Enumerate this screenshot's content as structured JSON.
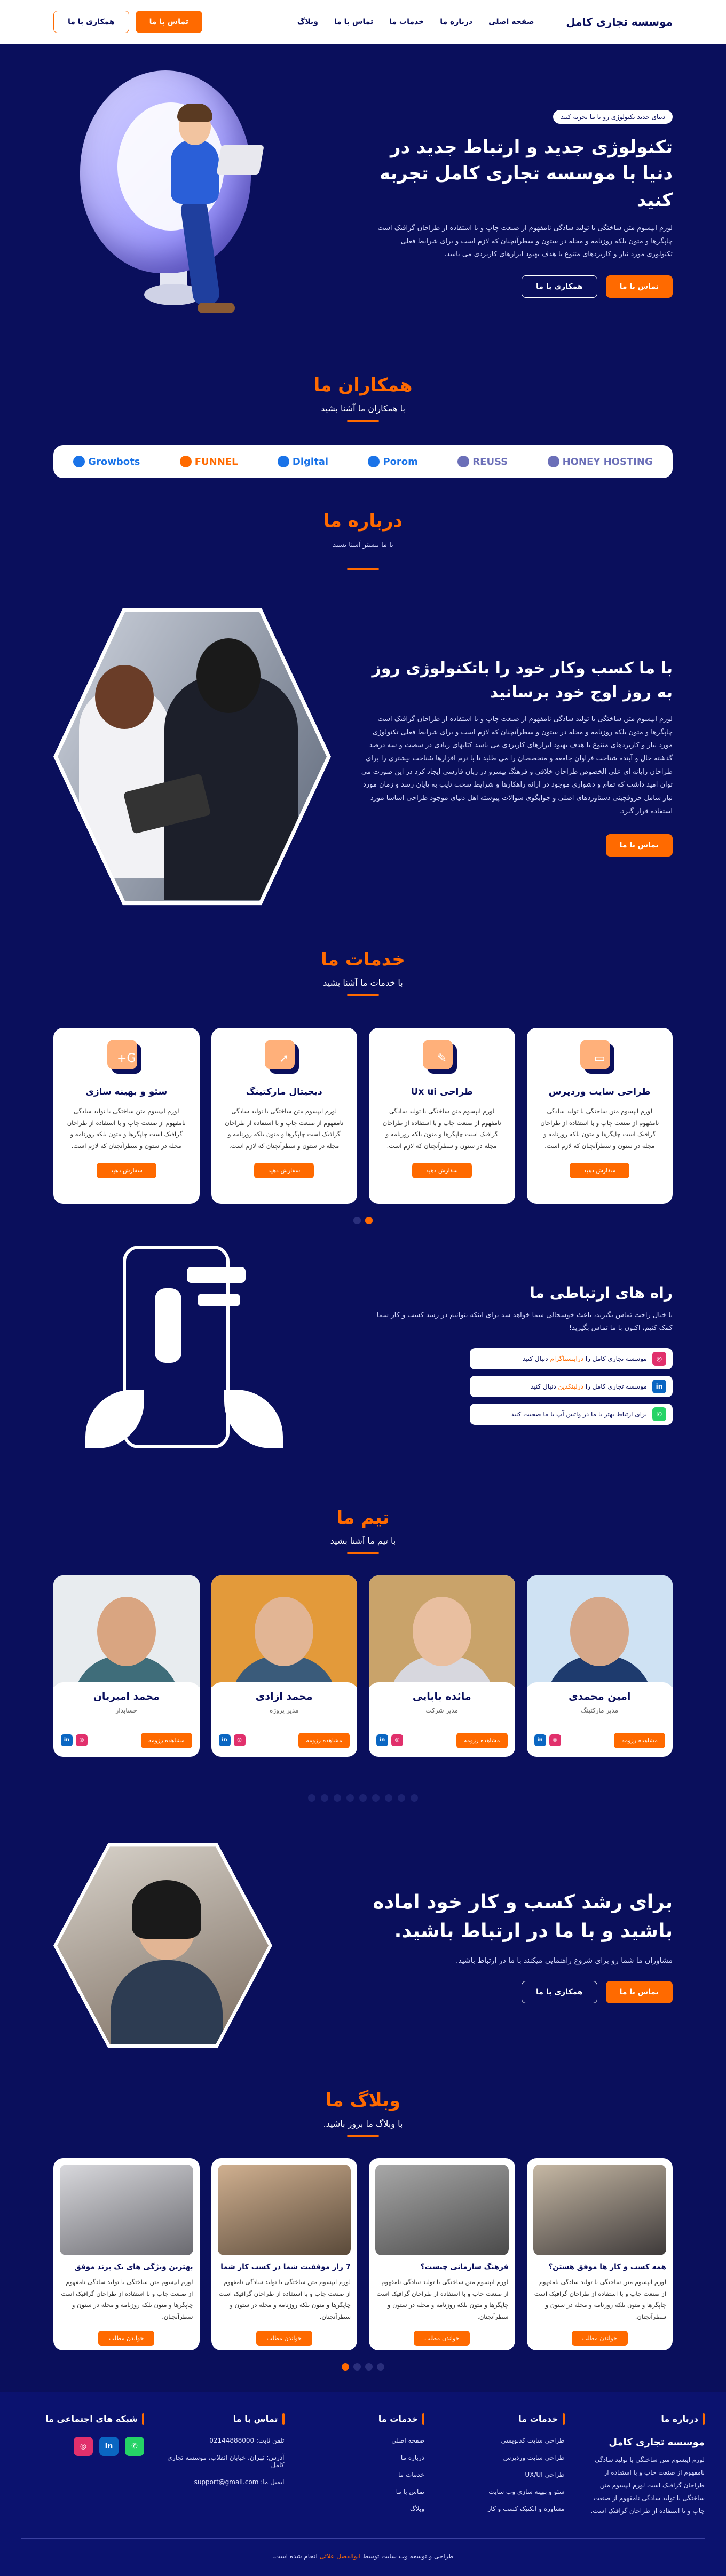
{
  "header": {
    "brand": "موسسه تجاری کامل",
    "nav": [
      "صفحه اصلی",
      "درباره ما",
      "خدمات ما",
      "تماس با ما",
      "وبلاگ"
    ],
    "contact_btn": "تماس با ما",
    "coop_btn": "همکاری با ما"
  },
  "hero": {
    "pill": "دنیای جدید تکنولوژی رو با ما تجربه کنید",
    "title": "تکنولوژی جدید و ارتباط جدید در دنیا با موسسه تجاری کامل تجربه کنید",
    "desc": "لورم ایپسوم متن ساختگی با تولید سادگی نامفهوم از صنعت چاپ و با استفاده از طراحان گرافیک است چاپگرها و متون بلکه روزنامه و مجله در ستون و سطرآنچنان که لازم است و برای شرایط فعلی تکنولوژی مورد نیاز و کاربردهای متنوع با هدف بهبود ابزارهای کاربردی می باشد.",
    "contact_btn": "تماس با ما",
    "coop_btn": "همکاری با ما"
  },
  "partners": {
    "title": "همکاران ما",
    "subtitle": "با همکاران ما آشنا بشید",
    "logos": [
      {
        "name": "Growbots",
        "color": "#1a73e8"
      },
      {
        "name": "FUNNEL",
        "color": "#ff6a00"
      },
      {
        "name": "Digital",
        "color": "#1a73e8"
      },
      {
        "name": "Porom",
        "color": "#1a73e8"
      },
      {
        "name": "REUSS",
        "color": "#6b6fb8"
      },
      {
        "name": "HONEY HOSTING",
        "color": "#6b6fb8"
      }
    ]
  },
  "about": {
    "title": "درباره ما",
    "subtitle": "با ما بیشتر آشنا بشید",
    "heading": "با ما کسب وکار خود را باتکنولوژی روز به روز اوج خود برسانید",
    "desc": "لورم ایپسوم متن ساختگی با تولید سادگی نامفهوم از صنعت چاپ و با استفاده از طراحان گرافیک است چاپگرها و متون بلکه روزنامه و مجله در ستون و سطرآنچنان که لازم است و برای شرایط فعلی تکنولوژی مورد نیاز و کاربردهای متنوع با هدف بهبود ابزارهای کاربردی می باشد کتابهای زیادی در شصت و سه درصد گذشته حال و آینده شناخت فراوان جامعه و متخصصان را می طلبد تا با نرم افزارها شناخت بیشتری را برای طراحان رایانه ای علی الخصوص طراحان خلاقی و فرهنگ پیشرو در زبان فارسی ایجاد کرد در این صورت می توان امید داشت که تمام و دشواری موجود در ارائه راهکارها و شرایط سخت تایپ به پایان رسد و زمان مورد نیاز شامل حروفچینی دستاوردهای اصلی و جوابگوی سوالات پیوسته اهل دنیای موجود طراحی اساسا مورد استفاده قرار گیرد.",
    "btn": "تماس با ما"
  },
  "services": {
    "title": "خدمات ما",
    "subtitle": "با خدمات ما آشنا بشید",
    "items": [
      {
        "title": "طراحی سایت وردپرس",
        "icon": "monitor-icon",
        "glyph": "▭",
        "desc": "لورم ایپسوم متن ساختگی با تولید سادگی نامفهوم از صنعت چاپ و با استفاده از طراحان گرافیک است چاپگرها و متون بلکه روزنامه و مجله در ستون و سطرآنچنان که لازم است.",
        "btn": "سفارش دهید"
      },
      {
        "title": "طراحی Ux ui",
        "icon": "pen-tool-icon",
        "glyph": "✎",
        "desc": "لورم ایپسوم متن ساختگی با تولید سادگی نامفهوم از صنعت چاپ و با استفاده از طراحان گرافیک است چاپگرها و متون بلکه روزنامه و مجله در ستون و سطرآنچنان که لازم است.",
        "btn": "سفارش دهید"
      },
      {
        "title": "دیجیتال مارکتینگ",
        "icon": "rocket-icon",
        "glyph": "➚",
        "desc": "لورم ایپسوم متن ساختگی با تولید سادگی نامفهوم از صنعت چاپ و با استفاده از طراحان گرافیک است چاپگرها و متون بلکه روزنامه و مجله در ستون و سطرآنچنان که لازم است.",
        "btn": "سفارش دهید"
      },
      {
        "title": "سئو و بهینه سازی",
        "icon": "google-plus-icon",
        "glyph": "G+",
        "desc": "لورم ایپسوم متن ساختگی با تولید سادگی نامفهوم از صنعت چاپ و با استفاده از طراحان گرافیک است چاپگرها و متون بلکه روزنامه و مجله در ستون و سطرآنچنان که لازم است.",
        "btn": "سفارش دهید"
      }
    ]
  },
  "contact": {
    "title": "راه های ارتباطی ما",
    "desc": "با خیال راحت تماس بگیرید، باعث خوشحالی شما خواهد شد برای اینکه بتوانیم در رشد کسب و کار شما کمک کنیم، اکنون با ما تماس بگیرید!",
    "items": [
      {
        "text": "موسسه تجاری کامل را",
        "link": "دراینستاگرام",
        "after": "دنبال کنید",
        "icon": "instagram-icon",
        "glyph": "◎",
        "color": "#e1306c"
      },
      {
        "text": "موسسه تجاری کامل را",
        "link": "درلینکدین",
        "after": "دنبال کنید",
        "icon": "linkedin-icon",
        "glyph": "in",
        "color": "#0a66c2"
      },
      {
        "text": "برای ارتباط بهتر با ما در واتس آپ با ما صحبت کنید",
        "link": "",
        "after": "",
        "icon": "whatsapp-icon",
        "glyph": "✆",
        "color": "#25d366"
      }
    ]
  },
  "team": {
    "title": "تیم ما",
    "subtitle": "با تیم ما آشنا بشید",
    "members": [
      {
        "name": "امین محمدی",
        "role": "مدیر مارکتینگ",
        "btn": "مشاهده رزومه",
        "skin": "#d6a88a",
        "cloth": "#1e3b6e",
        "bg": "#cfe2f3"
      },
      {
        "name": "مائده بابایی",
        "role": "مدیر شرکت",
        "btn": "مشاهده رزومه",
        "skin": "#e9bfa0",
        "cloth": "#d7d7de",
        "bg": "#c9a36a"
      },
      {
        "name": "محمد ازادی",
        "role": "مدیر پروژه",
        "btn": "مشاهده رزومه",
        "skin": "#e2b594",
        "cloth": "#3a5b7a",
        "bg": "#e39a3a"
      },
      {
        "name": "محمد امیریان",
        "role": "حسابدار",
        "btn": "مشاهده رزومه",
        "skin": "#d9a581",
        "cloth": "#3f6d7a",
        "bg": "#e8ecef"
      }
    ],
    "dot_count": 9,
    "active_dot": 4
  },
  "cta": {
    "title": "برای رشد کسب و کار خود اماده باشید و با ما در ارتباط باشید.",
    "desc": "مشاوران ما شما رو برای شروع راهنمایی میکنند با ما در ارتباط باشید.",
    "contact_btn": "تماس با ما",
    "coop_btn": "همکاری با ما"
  },
  "blog": {
    "title": "وبلاگ ما",
    "subtitle": "با وبلاگ ما بروز باشید.",
    "posts": [
      {
        "title": "همه کسب و کار ها موفق هستن؟",
        "desc": "لورم ایپسوم متن ساختگی با تولید سادگی نامفهوم از صنعت چاپ و با استفاده از طراحان گرافیک است چاپگرها و متون بلکه روزنامه و مجله در ستون و سطرآنچنان.",
        "btn": "خواندن مطلب",
        "bg1": "#c6b8a4",
        "bg2": "#3e3a3a"
      },
      {
        "title": "فرهنگ سازمانی چیست؟",
        "desc": "لورم ایپسوم متن ساختگی با تولید سادگی نامفهوم از صنعت چاپ و با استفاده از طراحان گرافیک است چاپگرها و متون بلکه روزنامه و مجله در ستون و سطرآنچنان.",
        "btn": "خواندن مطلب",
        "bg1": "#a8a8a8",
        "bg2": "#4a4a4a"
      },
      {
        "title": "7 راز موفقیت شما در کسب کار شما",
        "desc": "لورم ایپسوم متن ساختگی با تولید سادگی نامفهوم از صنعت چاپ و با استفاده از طراحان گرافیک است چاپگرها و متون بلکه روزنامه و مجله در ستون و سطرآنچنان.",
        "btn": "خواندن مطلب",
        "bg1": "#d0b090",
        "bg2": "#5a4a3a"
      },
      {
        "title": "بهترین ویژگی های یک برند موفق",
        "desc": "لورم ایپسوم متن ساختگی با تولید سادگی نامفهوم از صنعت چاپ و با استفاده از طراحان گرافیک است چاپگرها و متون بلکه روزنامه و مجله در ستون و سطرآنچنان.",
        "btn": "خواندن مطلب",
        "bg1": "#d8d8dc",
        "bg2": "#6a6a70"
      }
    ],
    "dot_count": 4,
    "active_dot": 0
  },
  "footer": {
    "about_title": "درباره ما",
    "about_brand": "موسسه تجاری کامل",
    "about_desc": "لورم ایپسوم متن ساختگی با تولید سادگی نامفهوم از صنعت چاپ و با استفاده از طراحان گرافیک است لورم ایپسوم متن ساختگی با تولید سادگی نامفهوم از صنعت چاپ و با استفاده از طراحان گرافیک است.",
    "services_title": "خدمات ما",
    "services": [
      "طراحی سایت کدنویسی",
      "طراحی سایت وردپرس",
      "طراحی UX/UI",
      "سئو و بهینه سازی وب سایت",
      "مشاوره و اتکتیک کسب و کار"
    ],
    "links_title": "خدمات ما",
    "links": [
      "صفحه اصلی",
      "درباره ما",
      "خدمات ما",
      "تماس با ما",
      "وبلاگ"
    ],
    "contact_title": "تماس با ما",
    "phone": "تلفن ثابت: 02144888000",
    "address": "آدرس: تهران، خیابان انقلاب، موسسه تجاری کامل",
    "email": "ایمیل ما: support@gmail.com",
    "social_title": "شبکه های اجتماعی ما",
    "socials": [
      {
        "icon": "instagram-icon",
        "glyph": "◎",
        "color": "#e1306c"
      },
      {
        "icon": "linkedin-icon",
        "glyph": "in",
        "color": "#0a66c2"
      },
      {
        "icon": "whatsapp-icon",
        "glyph": "✆",
        "color": "#25d366"
      }
    ],
    "copy_pre": "طراحی و توسعه وب سایت توسط",
    "copy_name": "ابوالفضل علائی",
    "copy_post": "انجام شده است."
  }
}
